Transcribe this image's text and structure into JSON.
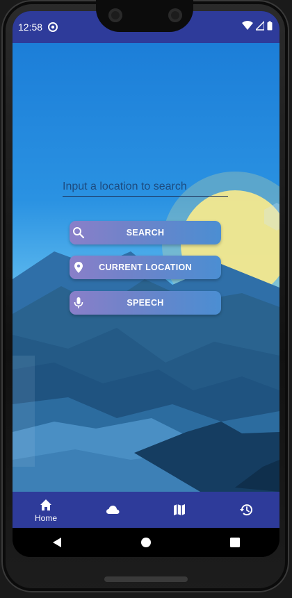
{
  "status_bar": {
    "time": "12:58",
    "app_icon": "at-sign-icon",
    "icons": [
      "wifi-icon",
      "signal-icon",
      "battery-icon"
    ]
  },
  "search": {
    "placeholder": "Input a location to search",
    "value": ""
  },
  "buttons": {
    "search": {
      "label": "SEARCH",
      "icon": "search-icon"
    },
    "current_location": {
      "label": "CURRENT LOCATION",
      "icon": "location-pin-icon"
    },
    "speech": {
      "label": "SPEECH",
      "icon": "microphone-icon"
    }
  },
  "bottom_nav": {
    "items": [
      {
        "label": "Home",
        "icon": "home-icon",
        "active": true
      },
      {
        "label": "",
        "icon": "cloud-icon",
        "active": false
      },
      {
        "label": "",
        "icon": "map-icon",
        "active": false
      },
      {
        "label": "",
        "icon": "history-icon",
        "active": false
      }
    ]
  },
  "system_nav": {
    "buttons": [
      "back-icon",
      "home-circle-icon",
      "recents-icon"
    ]
  },
  "colors": {
    "primary": "#2e3b9a",
    "sky": "#2a92e2",
    "sun": "#f2e88e"
  }
}
